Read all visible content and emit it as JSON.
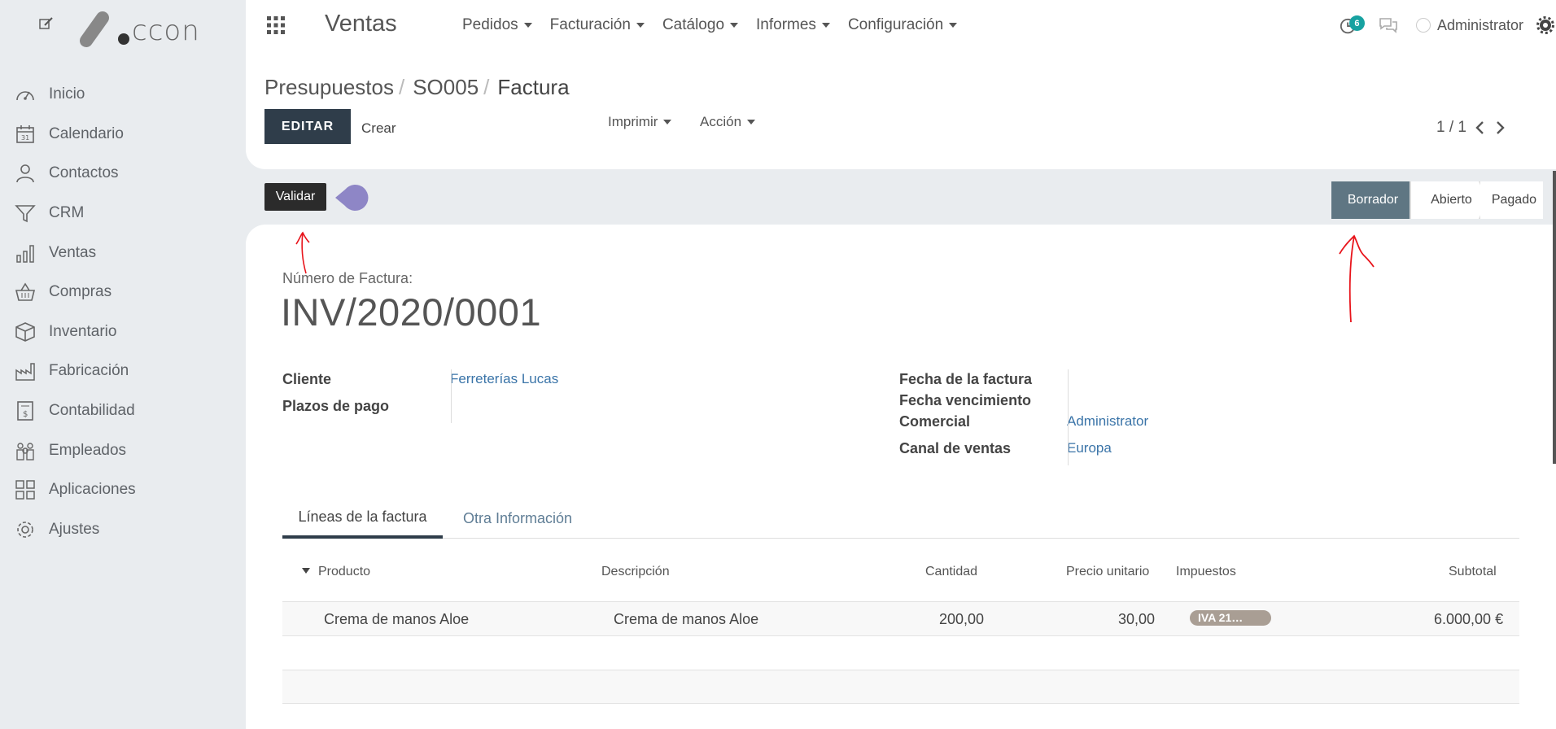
{
  "sidebar": {
    "logo_text": "ccon",
    "items": [
      {
        "label": "Inicio",
        "icon": "gauge-icon"
      },
      {
        "label": "Calendario",
        "icon": "calendar-icon"
      },
      {
        "label": "Contactos",
        "icon": "user-icon"
      },
      {
        "label": "CRM",
        "icon": "funnel-icon"
      },
      {
        "label": "Ventas",
        "icon": "bar-chart-icon"
      },
      {
        "label": "Compras",
        "icon": "basket-icon"
      },
      {
        "label": "Inventario",
        "icon": "box-icon"
      },
      {
        "label": "Fabricación",
        "icon": "factory-icon"
      },
      {
        "label": "Contabilidad",
        "icon": "invoice-icon"
      },
      {
        "label": "Empleados",
        "icon": "people-icon"
      },
      {
        "label": "Aplicaciones",
        "icon": "grid-icon"
      },
      {
        "label": "Ajustes",
        "icon": "gear-icon"
      }
    ]
  },
  "topbar": {
    "app_title": "Ventas",
    "menus": [
      "Pedidos",
      "Facturación",
      "Catálogo",
      "Informes",
      "Configuración"
    ],
    "activity_count": "6",
    "user_name": "Administrator"
  },
  "control_panel": {
    "breadcrumb": [
      "Presupuestos",
      "SO005",
      "Factura"
    ],
    "edit_label": "EDITAR",
    "create_label": "Crear",
    "print_label": "Imprimir",
    "action_label": "Acción",
    "pager": "1 / 1"
  },
  "statusbar": {
    "validate_label": "Validar",
    "stages": [
      "Borrador",
      "Abierto",
      "Pagado"
    ],
    "active_stage": "Borrador"
  },
  "invoice": {
    "number_label": "Número de Factura:",
    "number": "INV/2020/0001",
    "left_fields": [
      {
        "label": "Cliente",
        "value": "Ferreterías Lucas"
      },
      {
        "label": "Plazos de pago",
        "value": ""
      }
    ],
    "right_fields": [
      {
        "label": "Fecha de la factura",
        "value": ""
      },
      {
        "label": "Fecha vencimiento",
        "value": ""
      },
      {
        "label": "Comercial",
        "value": "Administrator"
      },
      {
        "label": "Canal de ventas",
        "value": "Europa"
      }
    ],
    "tabs": [
      "Líneas de la factura",
      "Otra Información"
    ],
    "columns": [
      "Producto",
      "Descripción",
      "Cantidad",
      "Precio unitario",
      "Impuestos",
      "Subtotal"
    ],
    "lines": [
      {
        "product": "Crema de manos Aloe",
        "description": "Crema de manos Aloe",
        "quantity": "200,00",
        "price": "30,00",
        "tax": "IVA 21…",
        "subtotal": "6.000,00 €"
      }
    ]
  },
  "colors": {
    "primary": "#2f3d4a",
    "stage_active": "#5f7683",
    "link": "#3a74a8",
    "badge": "#17a2a1",
    "annotation": "#e8141b"
  }
}
